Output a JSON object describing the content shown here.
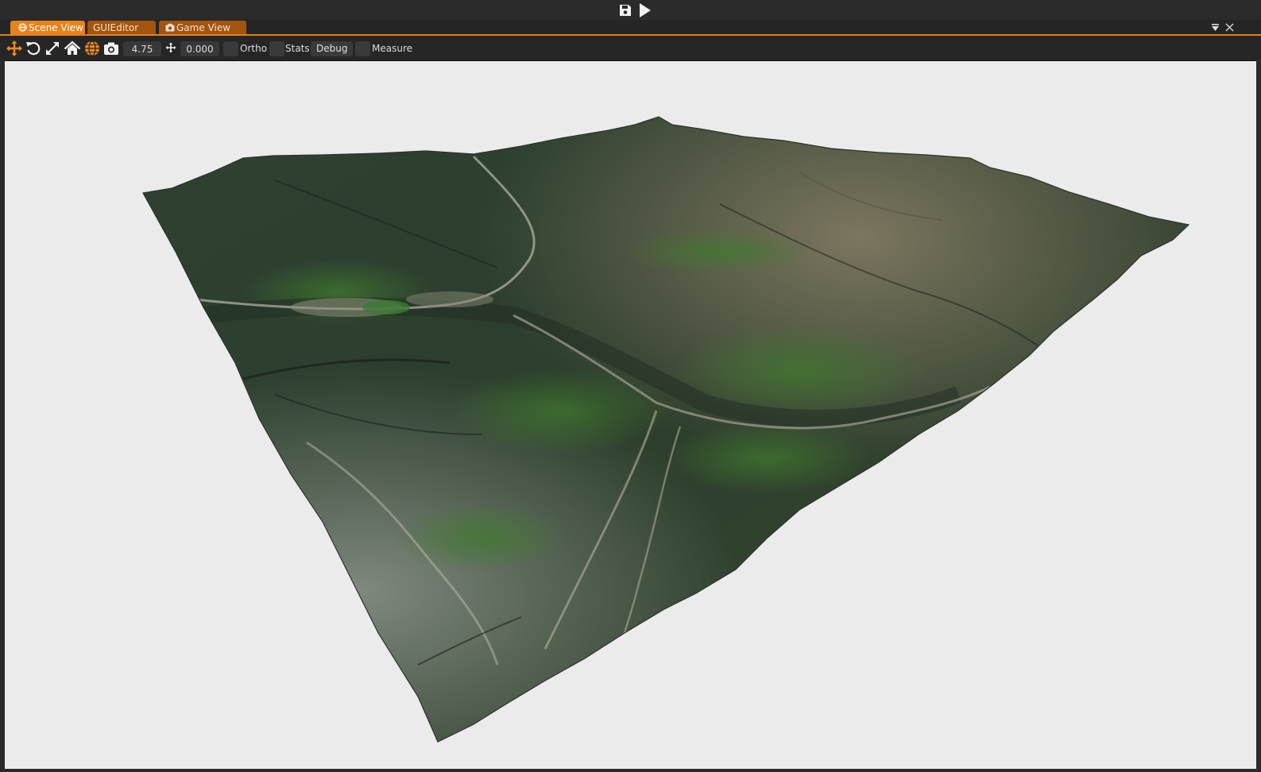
{
  "toolbar_top": {
    "save_icon": "floppy-disk-icon",
    "play_icon": "play-icon"
  },
  "tabs": [
    {
      "label": "Scene View",
      "icon": "globe-icon",
      "active": true
    },
    {
      "label": "GUIEditor",
      "icon": "",
      "active": false
    },
    {
      "label": "Game View",
      "icon": "camera-icon",
      "active": false
    }
  ],
  "window_controls": {
    "menu_icon": "dropdown-menu-icon",
    "close_icon": "close-icon"
  },
  "scene_toolbar": {
    "tools": [
      "move-gizmo-icon",
      "rotate-icon",
      "scale-icon",
      "home-icon",
      "world-space-icon",
      "screenshot-camera-icon"
    ],
    "camera_speed": "4.75",
    "snap_icon": "snap-move-icon",
    "snap_value": "0.000",
    "ortho_label": "Ortho",
    "stats_label": "Stats",
    "debug_label": "Debug",
    "measure_label": "Measure"
  },
  "viewport": {
    "background_color": "#ebebeb",
    "content": "3D terrain mesh with satellite texture",
    "accent_color": "#e8821b"
  }
}
